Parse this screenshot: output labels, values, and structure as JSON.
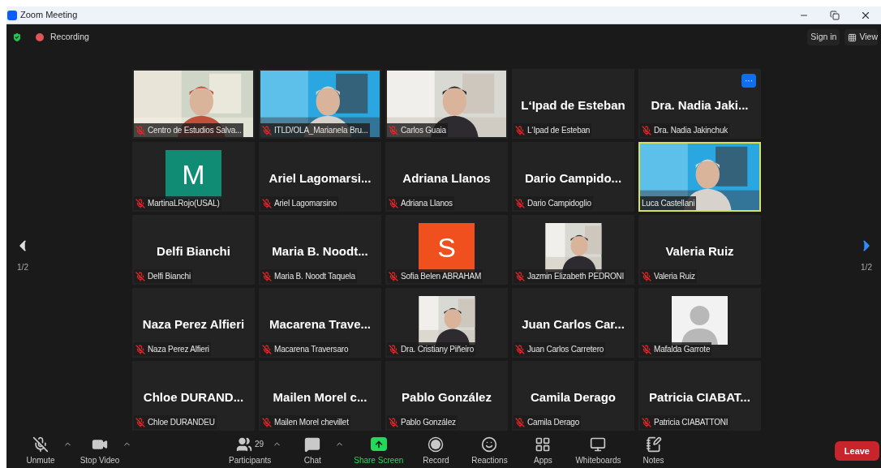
{
  "window": {
    "title": "Zoom Meeting"
  },
  "top_bar": {
    "recording": "Recording",
    "sign_in": "Sign in",
    "view": "View"
  },
  "pager": {
    "left": "1/2",
    "right": "1/2"
  },
  "tiles": [
    {
      "kind": "video",
      "label": "Centro de Estudios Salva...",
      "muted": true,
      "speaking": false,
      "menu": false
    },
    {
      "kind": "video",
      "label": "ITLD/OLA_Marianela Bru...",
      "muted": true,
      "speaking": false,
      "menu": false
    },
    {
      "kind": "video",
      "label": "Carlos Guaia",
      "muted": true,
      "speaking": false,
      "menu": false
    },
    {
      "kind": "name",
      "display_name": "L‘Ipad de Esteban",
      "label": "L‘Ipad de Esteban",
      "muted": true,
      "speaking": false,
      "menu": false
    },
    {
      "kind": "name",
      "display_name": "Dra. Nadia Jaki...",
      "label": "Dra. Nadia Jakinchuk",
      "muted": true,
      "speaking": false,
      "menu": true,
      "menu_text": "···"
    },
    {
      "kind": "letter",
      "letter": "M",
      "color": "#0f8c73",
      "label": "MartinaLRojo(USAL)",
      "muted": true,
      "speaking": false,
      "menu": false
    },
    {
      "kind": "name",
      "display_name": "Ariel Lagomarsi...",
      "label": "Ariel Lagomarsino",
      "muted": true,
      "speaking": false,
      "menu": false
    },
    {
      "kind": "name",
      "display_name": "Adriana Llanos",
      "label": "Adriana Llanos",
      "muted": true,
      "speaking": false,
      "menu": false
    },
    {
      "kind": "name",
      "display_name": "Dario Campido...",
      "label": "Dario Campidoglio",
      "muted": true,
      "speaking": false,
      "menu": false
    },
    {
      "kind": "video",
      "label": "Luca Castellani",
      "muted": false,
      "speaking": true,
      "menu": false
    },
    {
      "kind": "name",
      "display_name": "Delfi Bianchi",
      "label": "Delfi Bianchi",
      "muted": true,
      "speaking": false,
      "menu": false
    },
    {
      "kind": "name",
      "display_name": "Maria B. Noodt...",
      "label": "Maria B. Noodt Taquela",
      "muted": true,
      "speaking": false,
      "menu": false
    },
    {
      "kind": "letter",
      "letter": "S",
      "color": "#f0501e",
      "label": "Sofia Belen ABRAHAM",
      "muted": true,
      "speaking": false,
      "menu": false
    },
    {
      "label": "Jazmin Elizabeth PEDRONI",
      "muted": true,
      "speaking": false,
      "menu": false
    },
    {
      "kind": "name",
      "display_name": "Valeria Ruiz",
      "label": "Valeria Ruiz",
      "muted": true,
      "speaking": false,
      "menu": false
    },
    {
      "kind": "name",
      "display_name": "Naza Perez Alfieri",
      "label": "Naza Perez Alfieri",
      "muted": true,
      "speaking": false,
      "menu": false
    },
    {
      "kind": "name",
      "display_name": "Macarena Trave...",
      "label": "Macarena Traversaro",
      "muted": true,
      "speaking": false,
      "menu": false
    },
    {
      "label": "Dra. Cristiany Piñeiro",
      "muted": true,
      "speaking": false,
      "menu": false
    },
    {
      "kind": "name",
      "display_name": "Juan Carlos Car...",
      "label": "Juan Carlos Carretero",
      "muted": true,
      "speaking": false,
      "menu": false
    },
    {
      "kind": "silhouette",
      "label": "Mafalda Garrote",
      "muted": true,
      "speaking": false,
      "menu": false
    },
    {
      "kind": "name",
      "display_name": "Chloe DURAND...",
      "label": "Chloe DURANDEU",
      "muted": true,
      "speaking": false,
      "menu": false
    },
    {
      "kind": "name",
      "display_name": "Mailen Morel c...",
      "label": "Mailen Morel chevillet",
      "muted": true,
      "speaking": false,
      "menu": false
    },
    {
      "kind": "name",
      "display_name": "Pablo González",
      "label": "Pablo González",
      "muted": true,
      "speaking": false,
      "menu": false
    },
    {
      "kind": "name",
      "display_name": "Camila Derago",
      "label": "Camila Derago",
      "muted": true,
      "speaking": false,
      "menu": false
    },
    {
      "kind": "name",
      "display_name": "Patricia CIABAT...",
      "label": "Patricia CIABATTONI",
      "muted": true,
      "speaking": false,
      "menu": false
    }
  ],
  "toolbar": [
    {
      "kind": "unmute",
      "label": "Unmute",
      "caret": true
    },
    {
      "kind": "video",
      "label": "Stop Video",
      "caret": true
    },
    {
      "kind": "participants",
      "label": "Participants",
      "count": "29",
      "caret": true
    },
    {
      "kind": "chat",
      "label": "Chat",
      "caret": true
    },
    {
      "kind": "share",
      "label": "Share Screen",
      "caret": false
    },
    {
      "kind": "record",
      "label": "Record",
      "caret": false
    },
    {
      "kind": "reactions",
      "label": "Reactions",
      "caret": false
    },
    {
      "kind": "apps",
      "label": "Apps",
      "caret": false
    },
    {
      "kind": "whiteboards",
      "label": "Whiteboards",
      "caret": false
    },
    {
      "kind": "notes",
      "label": "Notes",
      "caret": false
    }
  ],
  "leave": "Leave"
}
